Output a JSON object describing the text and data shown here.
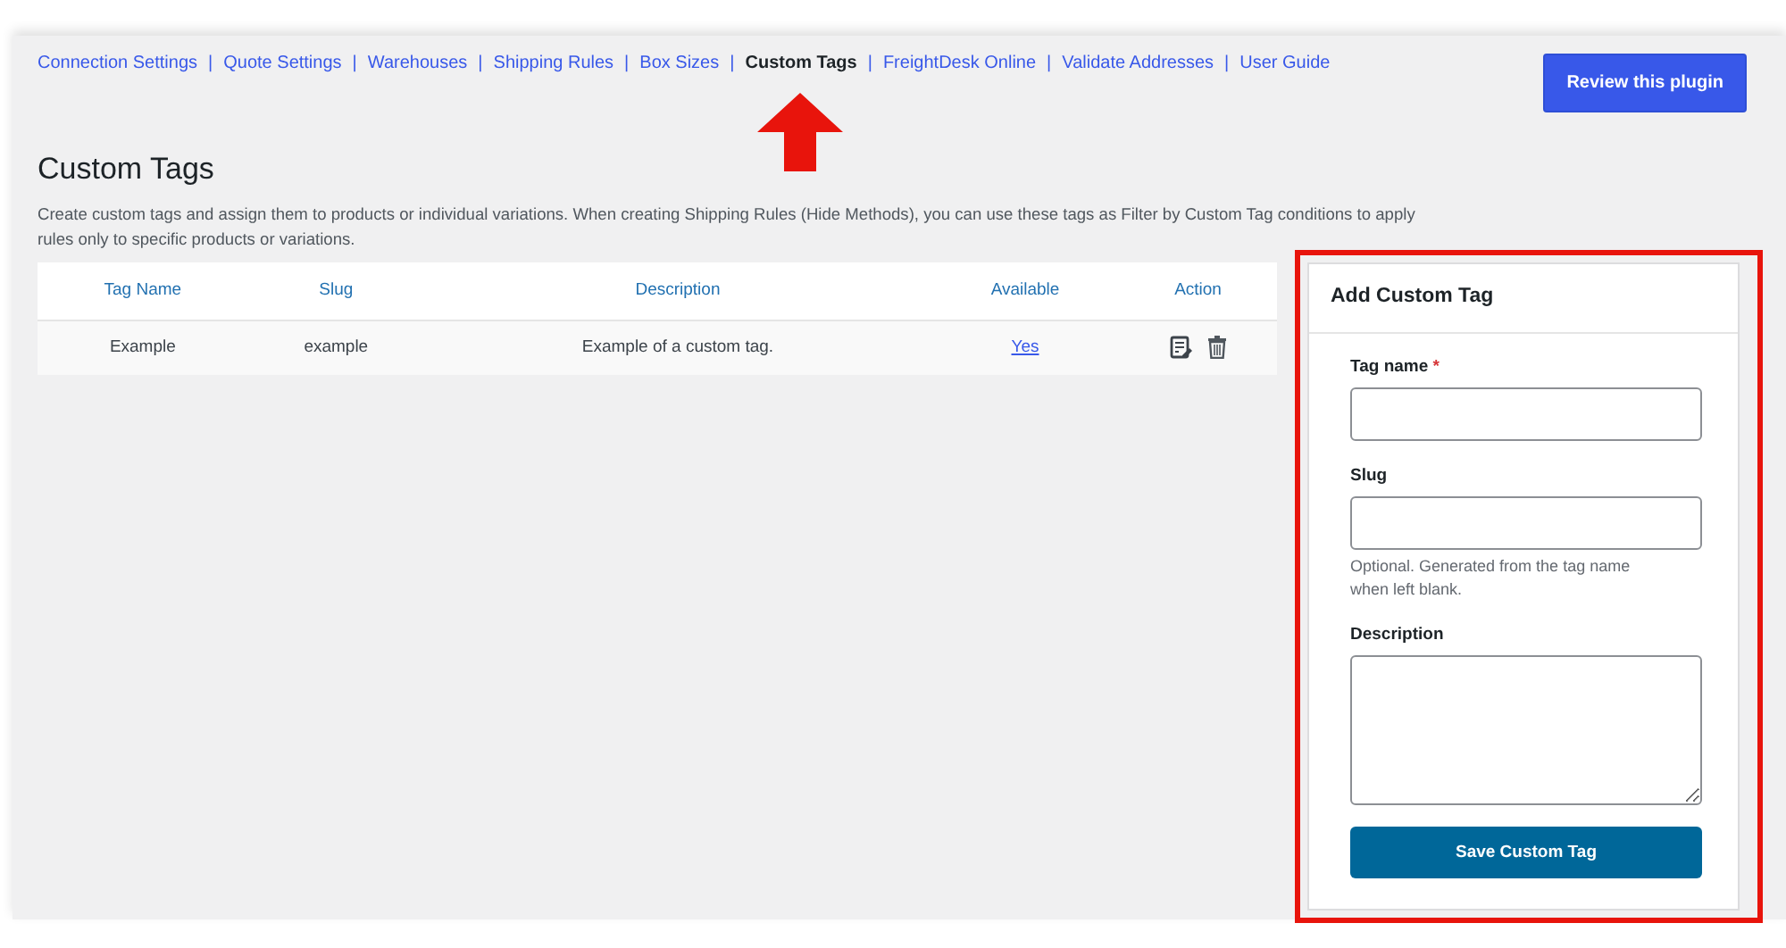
{
  "nav": [
    {
      "label": "Connection Settings",
      "selected": false
    },
    {
      "label": "Quote Settings",
      "selected": false
    },
    {
      "label": "Warehouses",
      "selected": false
    },
    {
      "label": "Shipping Rules",
      "selected": false
    },
    {
      "label": "Box Sizes",
      "selected": false
    },
    {
      "label": "Custom Tags",
      "selected": true
    },
    {
      "label": "FreightDesk Online",
      "selected": false
    },
    {
      "label": "Validate Addresses",
      "selected": false
    },
    {
      "label": "User Guide",
      "selected": false
    }
  ],
  "nav_separator": "|",
  "review_button": "Review this plugin",
  "page_title": "Custom Tags",
  "intro": "Create custom tags and assign them to products or individual variations. When creating Shipping Rules (Hide Methods), you can use these tags as Filter by Custom Tag conditions to apply rules only to specific products or variations.",
  "table": {
    "columns": [
      "Tag Name",
      "Slug",
      "Description",
      "Available",
      "Action"
    ],
    "rows": [
      {
        "tag_name": "Example",
        "slug": "example",
        "description": "Example of a custom tag.",
        "available": "Yes"
      }
    ]
  },
  "form": {
    "title": "Add Custom Tag",
    "fields": [
      {
        "kind": "input",
        "label": "Tag name",
        "required_mark": "*"
      },
      {
        "kind": "input",
        "label": "Slug",
        "help": "Optional. Generated from the tag name when left blank."
      },
      {
        "kind": "textarea",
        "label": "Description"
      }
    ],
    "submit": "Save Custom Tag"
  },
  "annotations": {
    "arrow": true,
    "highlight": true
  }
}
